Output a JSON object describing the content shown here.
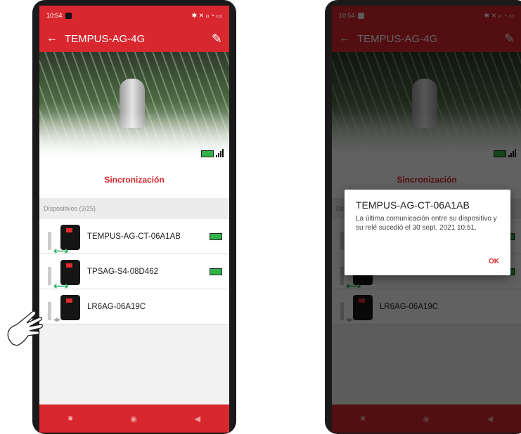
{
  "status": {
    "time": "10:54",
    "icons": "✱ ✕ ᵢₗₗ ◔ ▭"
  },
  "appbar": {
    "back": "←",
    "title": "TEMPUS-AG-4G",
    "edit": "✎"
  },
  "sync_label": "Sincronización",
  "section_label": "Dispositivos (3/25)",
  "devices": [
    {
      "name": "TEMPUS-AG-CT-06A1AB"
    },
    {
      "name": "TPSAG-S4-08D462"
    },
    {
      "name": "LR6AG-06A19C"
    }
  ],
  "nav": {
    "stop": "■",
    "home": "◉",
    "back": "◀"
  },
  "dialog": {
    "title": "TEMPUS-AG-CT-06A1AB",
    "message": "La última comunicación entre su dispositivo y su relé sucedió el 30 sept. 2021 10:51.",
    "ok": "OK"
  },
  "colors": {
    "brand_red": "#d8272e",
    "battery_green": "#33b24a",
    "arrow_green": "#2eb46a"
  }
}
